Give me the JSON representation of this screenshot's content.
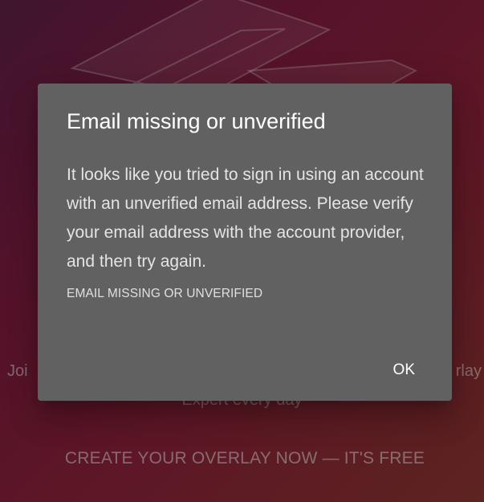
{
  "background": {
    "line1_left": "Joi",
    "line1_right": "rlay",
    "line2": "Expert every day",
    "cta": "CREATE YOUR OVERLAY NOW — IT'S FREE"
  },
  "dialog": {
    "title": "Email missing or unverified",
    "body": "It looks like you tried to sign in using an account with an unverified email address. Please verify your email address with the account provider, and then try again.",
    "code": "EMAIL MISSING OR UNVERIFIED",
    "ok_label": "OK"
  },
  "colors": {
    "dialog_bg": "#616161",
    "page_gradient_start": "#5e1f45",
    "page_gradient_end": "#8a3530"
  }
}
